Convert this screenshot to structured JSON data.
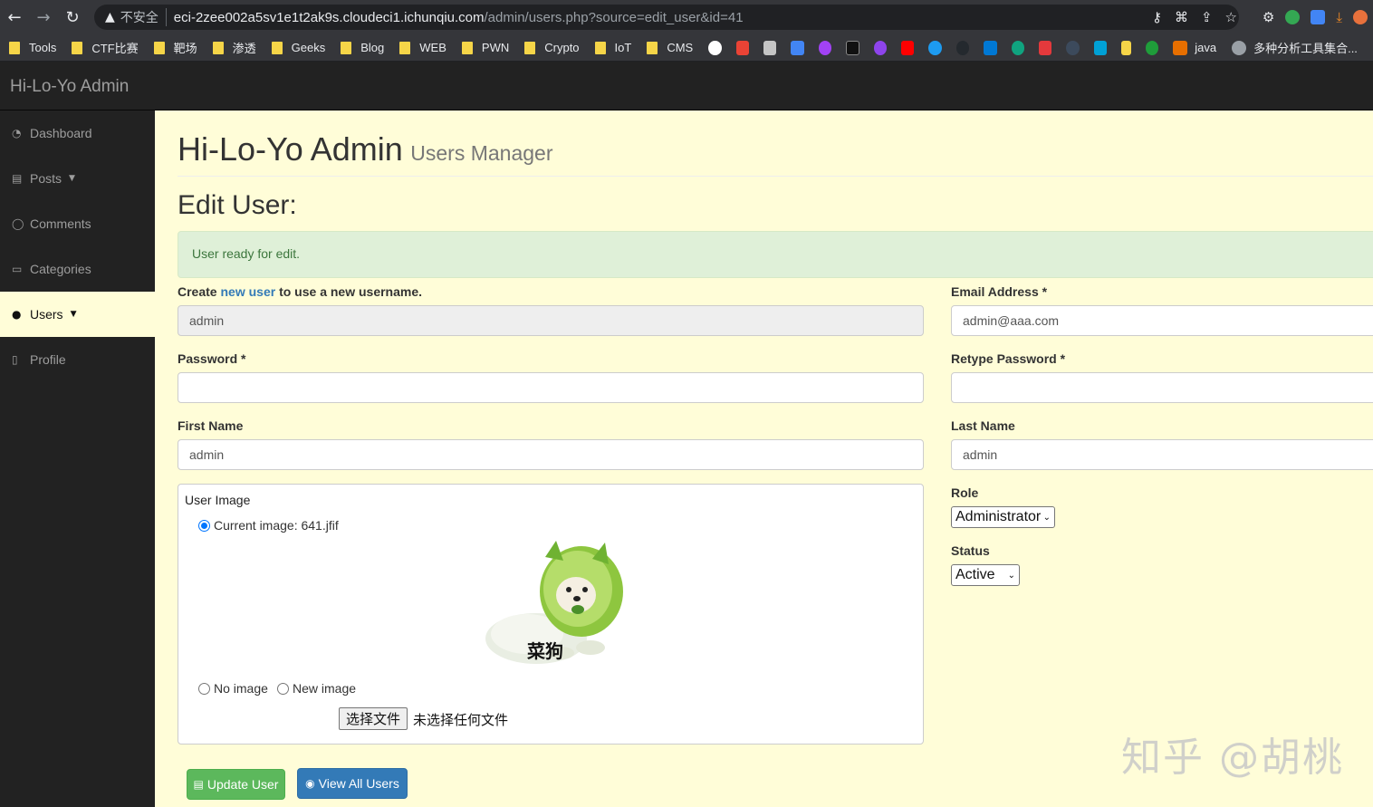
{
  "browser": {
    "insecure_label": "不安全",
    "url_host": "eci-2zee002a5sv1e1t2ak9s.cloudeci1.ichunqiu.com",
    "url_path": "/admin/users.php?source=edit_user&id=41",
    "bookmarks": [
      "Tools",
      "CTF比赛",
      "靶场",
      "渗透",
      "Geeks",
      "Blog",
      "WEB",
      "PWN",
      "Crypto",
      "IoT",
      "CMS"
    ],
    "bookmark_java": "java",
    "bookmark_tools": "多种分析工具集合..."
  },
  "app": {
    "brand": "Hi-Lo-Yo Admin"
  },
  "sidebar": {
    "items": [
      {
        "label": "Dashboard",
        "icon": "dashboard-icon"
      },
      {
        "label": "Posts",
        "icon": "files-icon"
      },
      {
        "label": "Comments",
        "icon": "comment-icon"
      },
      {
        "label": "Categories",
        "icon": "folder-open-icon"
      },
      {
        "label": "Users",
        "icon": "users-icon"
      },
      {
        "label": "Profile",
        "icon": "file-text-icon"
      }
    ]
  },
  "page": {
    "title": "Hi-Lo-Yo Admin",
    "subtitle": "Users Manager",
    "heading": "Edit User:",
    "alert": "User ready for edit."
  },
  "form": {
    "username_hint_pre": "Create",
    "username_hint_link": "new user",
    "username_hint_post": "to use a new username.",
    "username_value": "admin",
    "email_label": "Email Address *",
    "email_value": "admin@aaa.com",
    "password_label": "Password *",
    "retype_label": "Retype Password *",
    "first_name_label": "First Name",
    "first_name_value": "admin",
    "last_name_label": "Last Name",
    "last_name_value": "admin",
    "user_image_label": "User Image",
    "current_image_label": "Current image: 641.jfif",
    "image_caption": "菜狗",
    "no_image_label": "No image",
    "new_image_label": "New image",
    "file_button": "选择文件",
    "file_status": "未选择任何文件",
    "role_label": "Role",
    "role_value": "Administrator",
    "status_label": "Status",
    "status_value": "Active",
    "update_button": "Update User",
    "view_button": "View All Users"
  },
  "watermark": "知乎 @胡桃",
  "colors": {
    "sidebar_bg": "#222222",
    "main_bg": "#fffdd8",
    "success": "#5cb85c",
    "primary": "#337ab7",
    "alert_bg": "#dff0d8"
  }
}
